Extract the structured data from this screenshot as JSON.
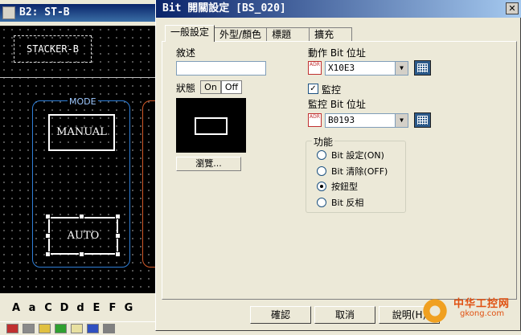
{
  "editor": {
    "title": "B2: ST-B",
    "stacker_label": "STACKER-B",
    "mode_label": "MODE",
    "manual_label": "MANUAL",
    "auto_label": "AUTO",
    "font_toolbar": [
      "A",
      "a",
      "C",
      "D",
      "d",
      "E",
      "F",
      "G"
    ]
  },
  "dialog": {
    "title": "Bit 開關設定 [BS_020]",
    "close_label": "✕",
    "tabs": [
      {
        "label": "一般設定",
        "active": true
      },
      {
        "label": "外型/顏色",
        "active": false
      },
      {
        "label": "標題",
        "active": false
      },
      {
        "label": "擴充",
        "active": false
      }
    ],
    "description_label": "敘述",
    "description_value": "",
    "state_label": "狀態",
    "state_on": "On",
    "state_off": "Off",
    "browse_label": "瀏覽...",
    "action_address_label": "動作 Bit 位址",
    "action_address_value": "X10E3",
    "monitor_checkbox_label": "監控",
    "monitor_checked": true,
    "monitor_address_label": "監控 Bit 位址",
    "monitor_address_value": "B0193",
    "function_group_label": "功能",
    "function_options": [
      {
        "label": "Bit 設定(ON)",
        "selected": false
      },
      {
        "label": "Bit 清除(OFF)",
        "selected": false
      },
      {
        "label": "按鈕型",
        "selected": true
      },
      {
        "label": "Bit 反相",
        "selected": false
      }
    ],
    "ok_label": "確認",
    "cancel_label": "取消",
    "help_label": "說明(H)"
  },
  "watermark": {
    "cn": "中华工控网",
    "en": "gkong.com"
  },
  "colors": {
    "title_bar": "#0a246a",
    "mode_frame": "#2f7fd8",
    "watermark": "#e05010"
  }
}
